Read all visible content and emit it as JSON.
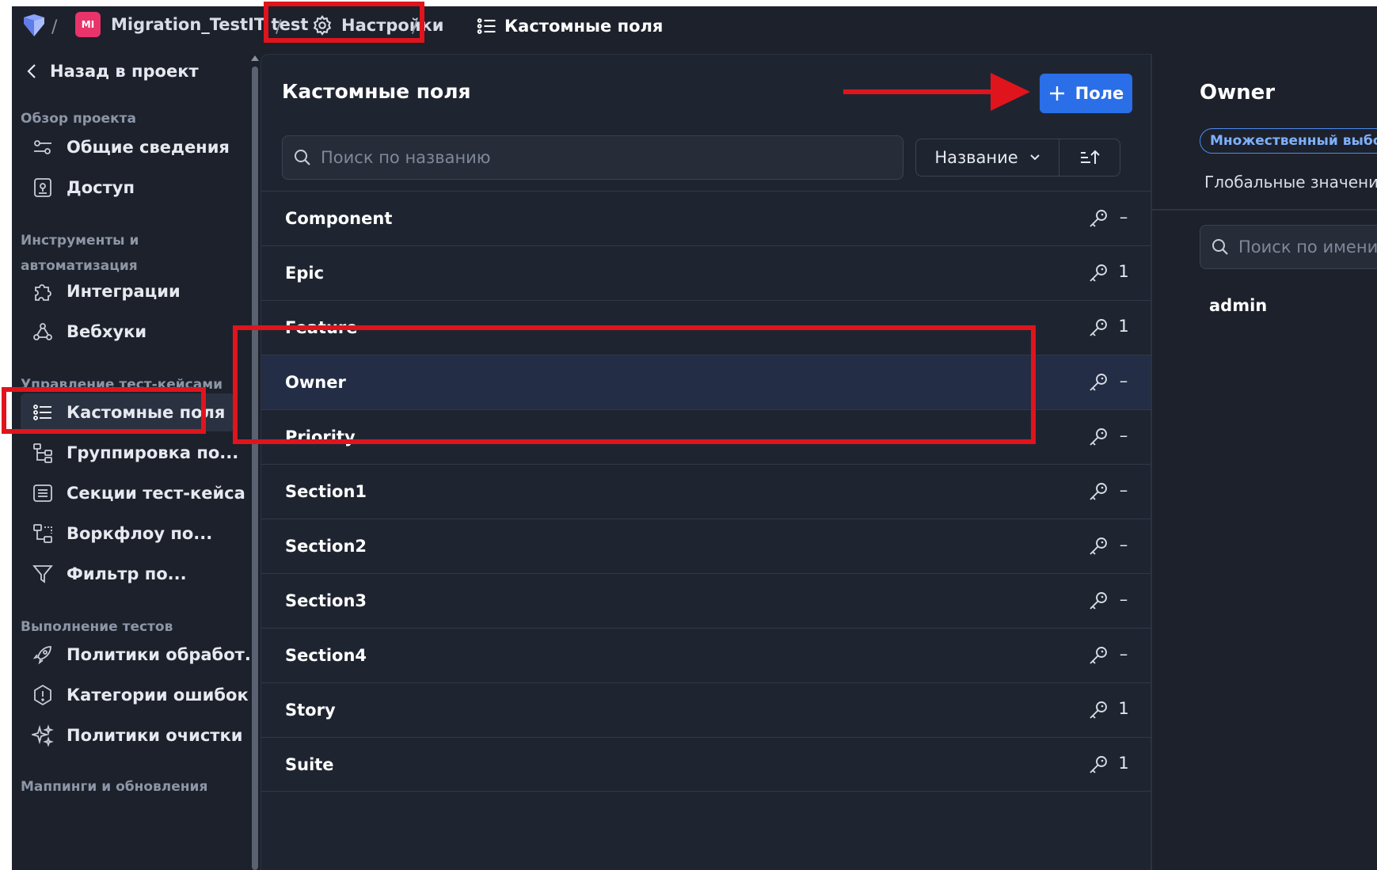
{
  "topbar": {
    "project_badge": "MI",
    "project_name": "Migration_TestIT test",
    "settings_label": "Настройки",
    "current_page": "Кастомные поля",
    "separator": "/"
  },
  "sidebar": {
    "back_label": "Назад в проект",
    "sections": [
      {
        "label": "Обзор проекта"
      },
      {
        "label": "Инструменты и автоматизация"
      },
      {
        "label": "Управление тест-кейсами"
      },
      {
        "label": "Выполнение тестов"
      },
      {
        "label": "Маппинги и обновления"
      }
    ],
    "items": [
      {
        "label": "Общие сведения",
        "icon": "sliders-icon"
      },
      {
        "label": "Доступ",
        "icon": "lock-icon"
      },
      {
        "label": "Интеграции",
        "icon": "puzzle-icon"
      },
      {
        "label": "Вебхуки",
        "icon": "webhook-icon"
      },
      {
        "label": "Кастомные поля",
        "icon": "list-icon"
      },
      {
        "label": "Группировка по...",
        "icon": "tree-icon"
      },
      {
        "label": "Секции тест-кейса",
        "icon": "sections-icon"
      },
      {
        "label": "Воркфлоу по...",
        "icon": "workflow-icon"
      },
      {
        "label": "Фильтр по...",
        "icon": "filter-icon"
      },
      {
        "label": "Политики обработ...",
        "icon": "rocket-icon"
      },
      {
        "label": "Категории ошибок",
        "icon": "alert-icon"
      },
      {
        "label": "Политики очистки",
        "icon": "sparkles-icon"
      }
    ]
  },
  "main": {
    "title": "Кастомные поля",
    "add_button_label": "Поле",
    "search_placeholder": "Поиск по названию",
    "sort_label": "Название",
    "fields": [
      {
        "name": "Component",
        "count": "–"
      },
      {
        "name": "Epic",
        "count": "1"
      },
      {
        "name": "Feature",
        "count": "1"
      },
      {
        "name": "Owner",
        "count": "–"
      },
      {
        "name": "Priority",
        "count": "–"
      },
      {
        "name": "Section1",
        "count": "–"
      },
      {
        "name": "Section2",
        "count": "–"
      },
      {
        "name": "Section3",
        "count": "–"
      },
      {
        "name": "Section4",
        "count": "–"
      },
      {
        "name": "Story",
        "count": "1"
      },
      {
        "name": "Suite",
        "count": "1"
      }
    ]
  },
  "detail": {
    "title": "Owner",
    "type_badge": "Множественный выбор",
    "tab_label": "Глобальные значения",
    "search_placeholder": "Поиск по имени",
    "values": [
      "admin"
    ]
  },
  "colors": {
    "accent": "#2a6ee8",
    "annotation": "#e0141c",
    "background": "#1c212b"
  }
}
